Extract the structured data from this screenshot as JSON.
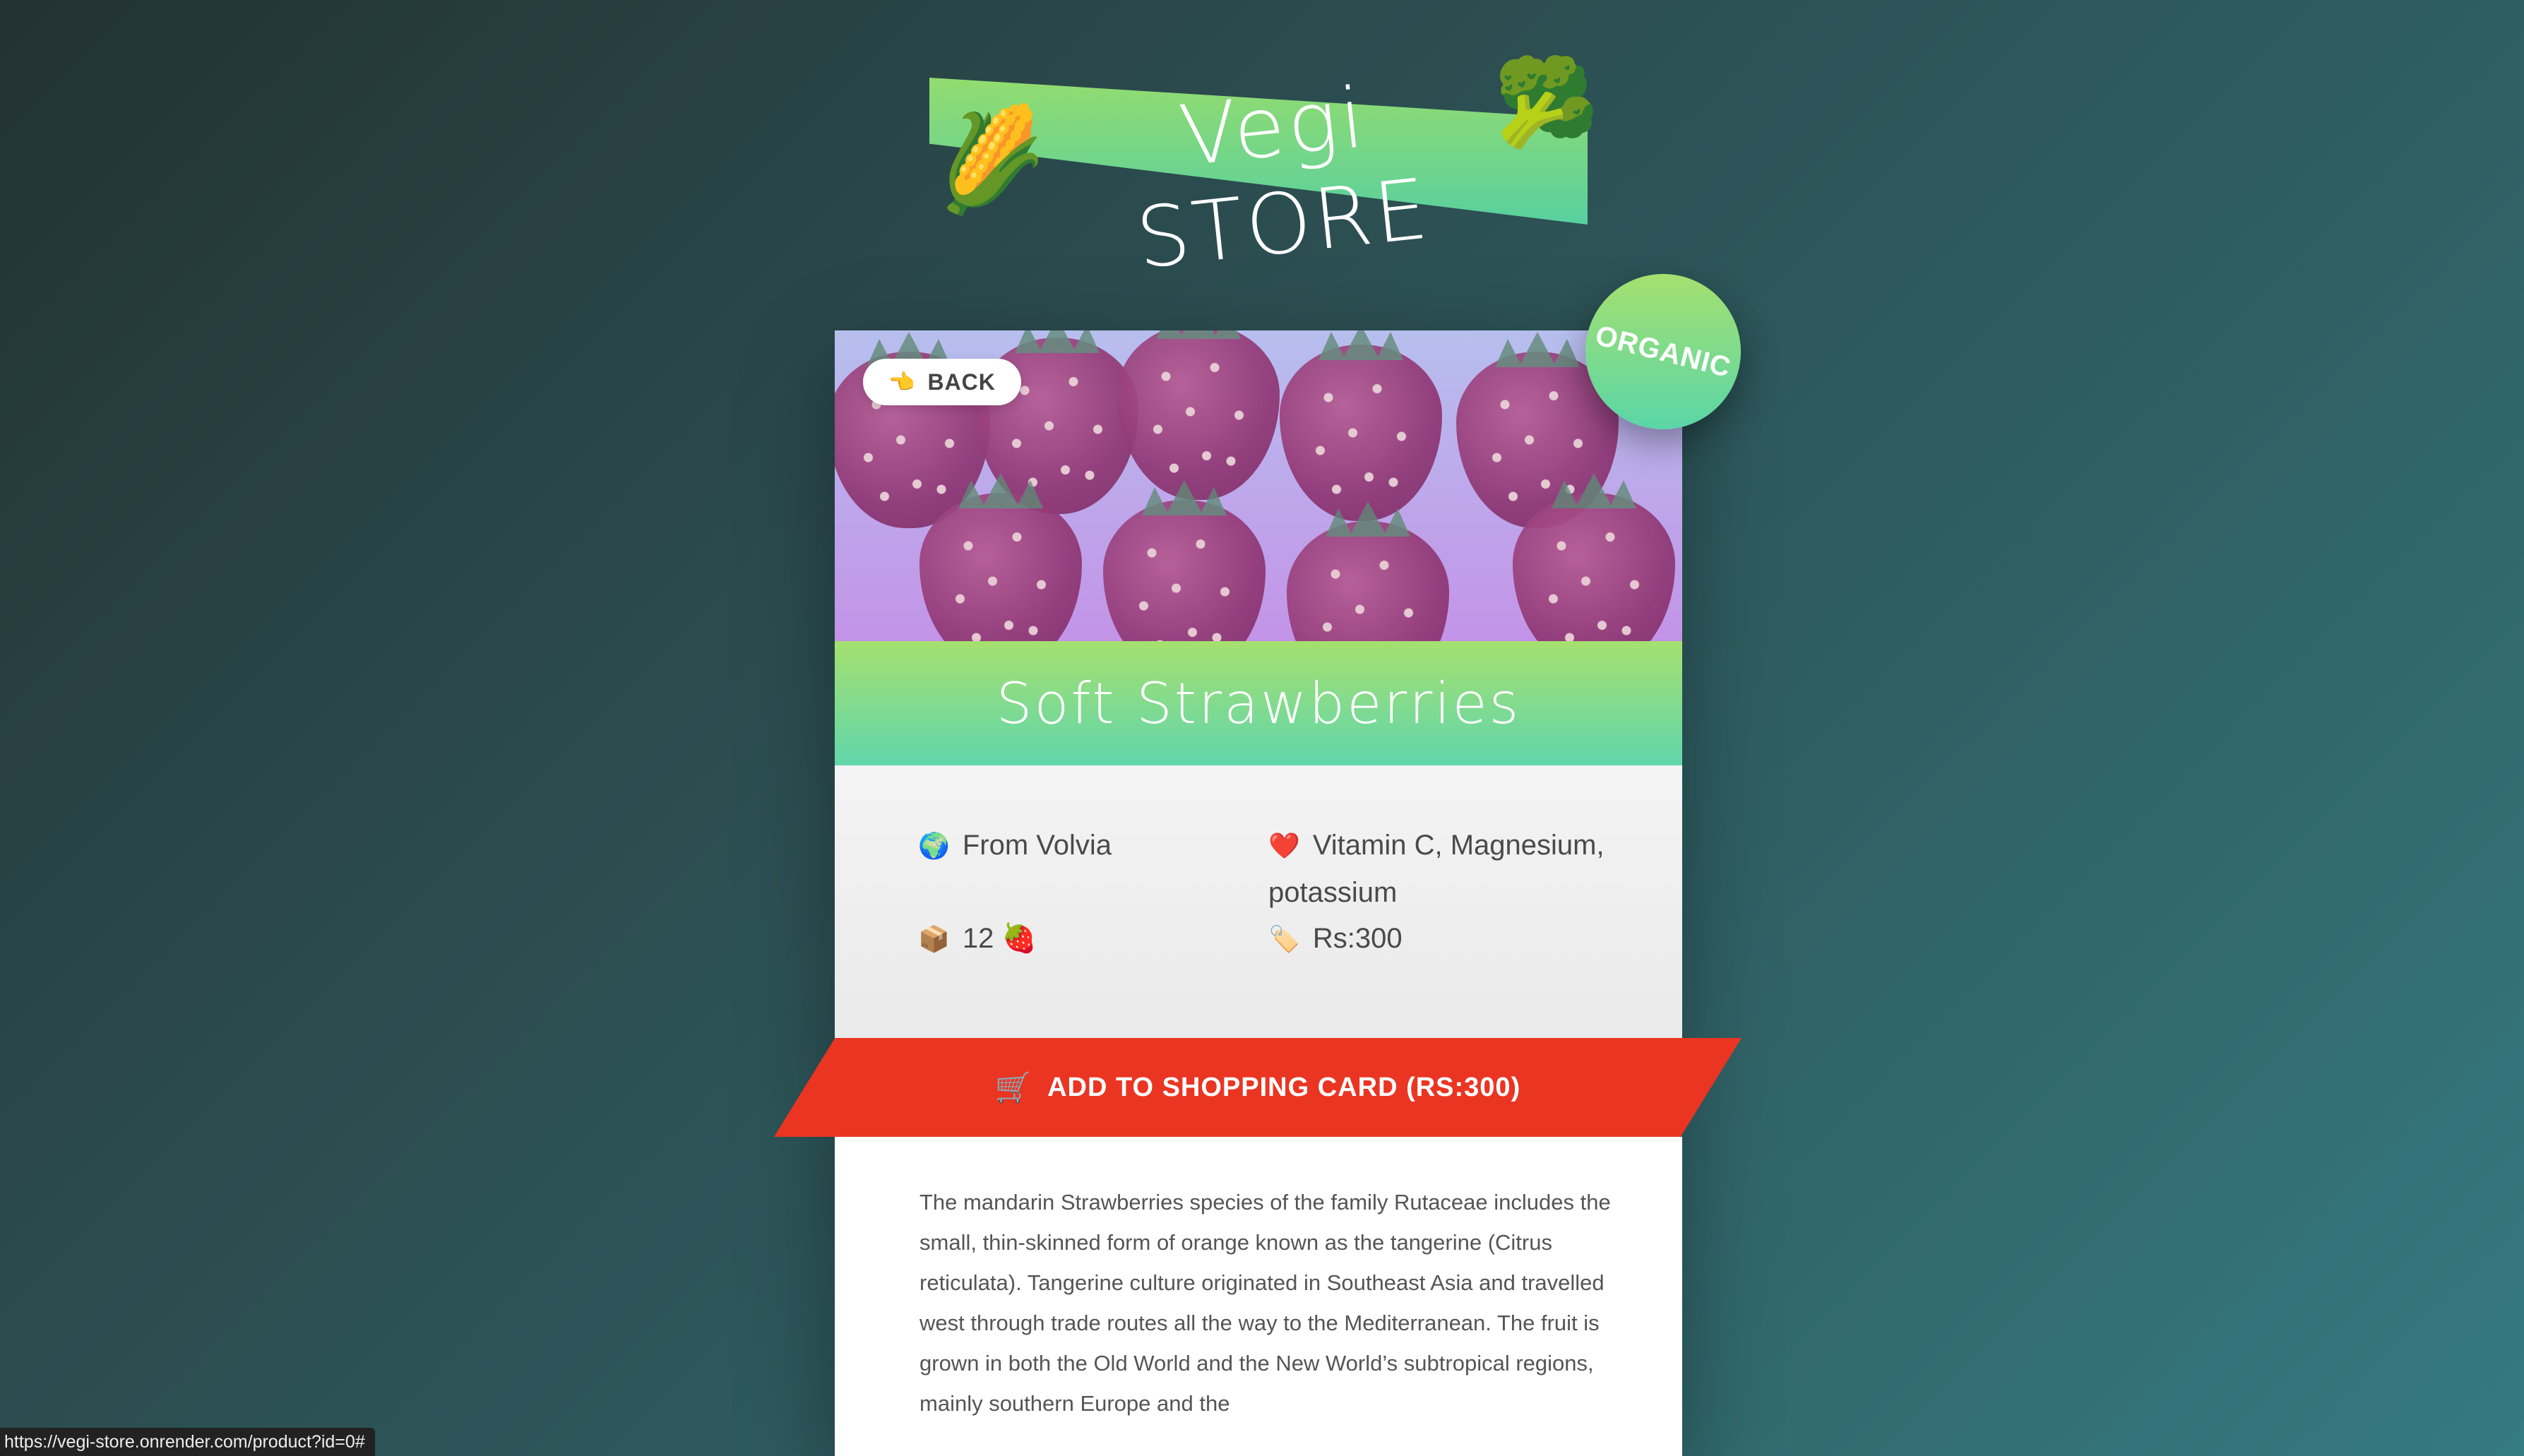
{
  "header": {
    "logo_text": "Vegi STORE",
    "logo_left_emoji": "🌽",
    "logo_right_emoji": "🥦"
  },
  "product": {
    "back_label": "BACK",
    "back_icon": "👈",
    "badge": "ORGANIC",
    "title": "Soft Strawberries",
    "origin_icon": "🌍",
    "origin": "From Volvia",
    "nutrients_icon": "❤️",
    "nutrients": "Vitamin C, Magnesium, potassium",
    "quantity_icon": "📦",
    "quantity": "12 🍓",
    "price_icon": "🏷️",
    "price": "Rs:300",
    "add_icon": "🛒",
    "add_label": "ADD TO SHOPPING CARD (RS:300)",
    "description": "The mandarin Strawberries species of the family Rutaceae includes the small, thin-skinned form of orange known as the tangerine (Citrus reticulata). Tangerine culture originated in Southeast Asia and travelled west through trade routes all the way to the Mediterranean. The fruit is grown in both the Old World and the New World’s subtropical regions, mainly southern Europe and the"
  },
  "status_bar": {
    "url": "https://vegi-store.onrender.com/product?id=0#"
  },
  "colors": {
    "accent_green": "#61d6ac",
    "button_red": "#ea3522"
  }
}
